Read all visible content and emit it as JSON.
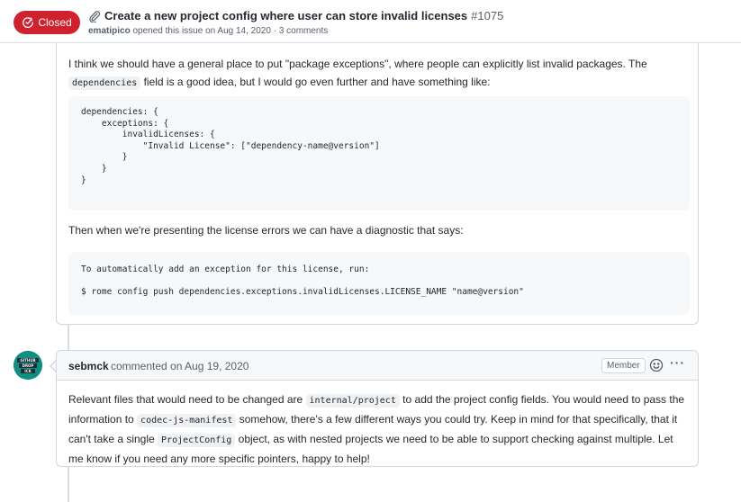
{
  "issue": {
    "state": "Closed",
    "title": "Create a new project config where user can store invalid licenses",
    "number": "#1075",
    "author": "ematipico",
    "opened_text": "opened this issue on Aug 14, 2020 · 3 comments"
  },
  "comment1": {
    "para1_a": "I think we should have a general place to put \"package exceptions\", where people can explicitly list invalid packages. The ",
    "para1_code": "dependencies",
    "para1_b": " field is a good idea, but I would go even further and have something like:",
    "code_block_1": "dependencies: {\n    exceptions: {\n        invalidLicenses: {\n            \"Invalid License\": [\"dependency-name@version\"]\n        }\n    }\n}",
    "para2": "Then when we're presenting the license errors we can have a diagnostic that says:",
    "code_block_2_line1": "To automatically add an exception for this license, run:",
    "code_block_2_line2": "$ rome config push dependencies.exceptions.invalidLicenses.LICENSE_NAME \"name@version\""
  },
  "comment2": {
    "avatar_text": "GITHUB DROP ICK",
    "author": "sebmck",
    "action": "commented on Aug 19, 2020",
    "badge": "Member",
    "more": "···",
    "body_1": "Relevant files that would need to be changed are ",
    "code_1": "internal/project",
    "body_2": " to add the project config fields. You would need to pass the information to ",
    "code_2": "codec-js-manifest",
    "body_3": " somehow, there's a few different ways you could try. Keep in mind for that specifically, that it can't take a single ",
    "code_3": "ProjectConfig",
    "body_4": " object, as with nested projects we need to be able to support checking against multiple. Let me know if you need any more specific pointers, happy to help!"
  },
  "icons": {
    "state": "issue-closed-icon",
    "title": "paperclip-icon",
    "reaction": "smiley-icon",
    "menu": "kebab-horizontal-icon"
  },
  "colors": {
    "closed_badge": "#cf222e",
    "avatar_bg": "#0e8f82",
    "border": "#d0d7de",
    "muted_text": "#57606a"
  }
}
